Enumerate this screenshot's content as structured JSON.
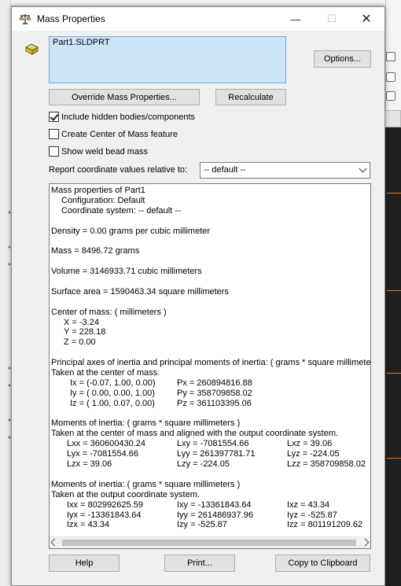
{
  "window": {
    "title": "Mass Properties",
    "minimize": "—",
    "maximize": "☐",
    "close": "✕"
  },
  "selection": {
    "items": [
      "Part1.SLDPRT"
    ]
  },
  "buttons": {
    "options": "Options...",
    "override": "Override Mass Properties...",
    "recalculate": "Recalculate",
    "help": "Help",
    "print": "Print...",
    "copy": "Copy to Clipboard"
  },
  "options": {
    "include_hidden": {
      "label": "Include hidden bodies/components",
      "checked": true
    },
    "create_com": {
      "label": "Create Center of Mass feature",
      "checked": false
    },
    "show_weld": {
      "label": "Show weld bead mass",
      "checked": false
    }
  },
  "report": {
    "label": "Report coordinate values relative to:",
    "selected": "-- default --"
  },
  "results": {
    "header": "Mass properties of Part1",
    "configuration": "Configuration: Default",
    "coord_system": "Coordinate system: -- default --",
    "density": "Density = 0.00 grams per cubic millimeter",
    "mass": "Mass = 8496.72 grams",
    "volume": "Volume = 3146933.71 cubic millimeters",
    "surface_area": "Surface area = 1590463.34  square millimeters",
    "com_header": "Center of mass: ( millimeters )",
    "com_x": "X = -3.24",
    "com_y": "Y = 228.18",
    "com_z": "Z = 0.00",
    "principal_header": "Principal axes of inertia and principal moments of inertia: ( grams *  square millimeters )",
    "principal_taken": "Taken at the center of mass.",
    "ix": "Ix = (-0.07,  1.00,  0.00)",
    "iy": "Iy = ( 0.00,  0.00,  1.00)",
    "iz": "Iz = ( 1.00,  0.07,  0.00)",
    "px": "Px = 260894816.88",
    "py": "Py = 358709858.02",
    "pz": "Pz = 361103395.06",
    "moi_header": "Moments of inertia: ( grams *  square millimeters )",
    "moi_taken": "Taken at the center of mass and aligned with the output coordinate system.",
    "lxx": "Lxx = 360600430.24",
    "lxy": "Lxy = -7081554.66",
    "lxz": "Lxz = 39.06",
    "lyx": "Lyx = -7081554.66",
    "lyy": "Lyy = 261397781.71",
    "lyz": "Lyz = -224.05",
    "lzx": "Lzx = 39.06",
    "lzy": "Lzy = -224.05",
    "lzz": "Lzz = 358709858.02",
    "moi2_header": "Moments of inertia: ( grams *  square millimeters )",
    "moi2_taken": "Taken at the output coordinate system.",
    "ixx": "Ixx = 802992625.59",
    "ixy": "Ixy = -13361843.64",
    "ixz": "Ixz = 43.34",
    "iyx": "Iyx = -13361843.64",
    "iyy": "Iyy = 261486937.96",
    "iyz": "Iyz = -525.87",
    "izx": "Izx = 43.34",
    "izy": "Izy = -525.87",
    "izz": "Izz = 801191209.62"
  },
  "colors": {
    "selection_bg": "#cce4f7",
    "dialog_bg": "#f0f0f0",
    "button_bg": "#e1e1e1",
    "accent_orange": "#e07a1f"
  }
}
